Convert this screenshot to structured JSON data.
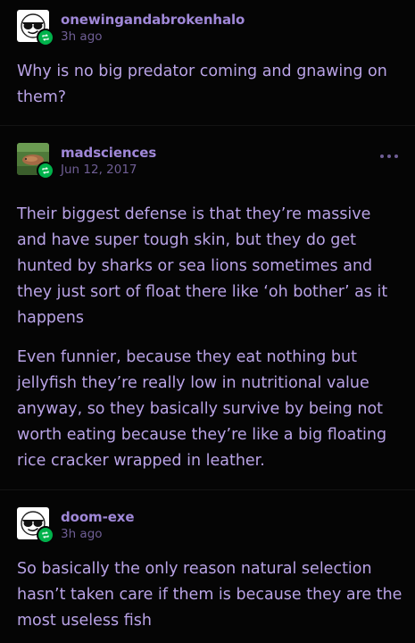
{
  "colors": {
    "background": "#050505",
    "text": "#b9a3e6",
    "username": "#a088d8",
    "timestamp": "#6f5e95",
    "badge": "#00b24b"
  },
  "posts": [
    {
      "username": "onewingandabrokenhalo",
      "timestamp": "3h ago",
      "avatar_icon": "sunglasses-emoji-avatar",
      "badge_icon": "reblog-icon",
      "paragraphs": [
        "Why is no big predator coming and gnawing on them?"
      ]
    },
    {
      "username": "madsciences",
      "timestamp": "Jun 12, 2017",
      "avatar_icon": "photo-avatar",
      "badge_icon": "reblog-icon",
      "menu_icon": "more-options-icon",
      "paragraphs": [
        "Their biggest defense is that they’re massive and have super tough skin, but they do get hunted by sharks or sea lions sometimes and they just sort of float there like ‘oh bother’ as it happens",
        "Even funnier, because they eat nothing but jellyfish they’re really low in nutritional value anyway, so they basically survive by being not worth eating because they’re like a big floating rice cracker wrapped in leather."
      ]
    },
    {
      "username": "doom-exe",
      "timestamp": "3h ago",
      "avatar_icon": "sunglasses-emoji-avatar",
      "badge_icon": "reblog-icon",
      "paragraphs": [
        "So basically the only reason natural selection hasn’t taken care if them is because they are the most useless fish"
      ]
    }
  ]
}
